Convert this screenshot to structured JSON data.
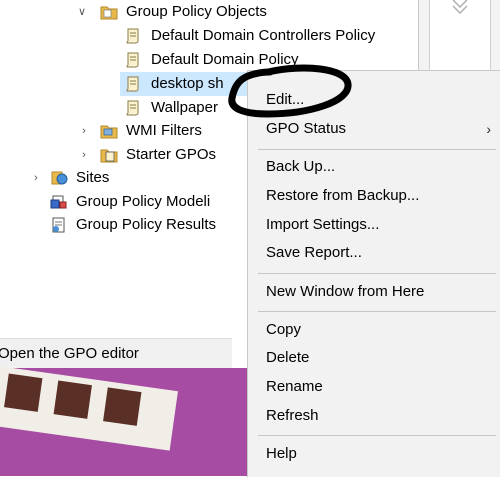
{
  "tree": {
    "items": [
      {
        "label": "Group Policy Objects",
        "icon": "folder-icon",
        "expander": "expanded"
      },
      {
        "label": "Default Domain Controllers Policy",
        "icon": "gpo-scroll-icon"
      },
      {
        "label": "Default Domain Policy",
        "icon": "gpo-scroll-icon"
      },
      {
        "label": "desktop sh",
        "icon": "gpo-scroll-icon"
      },
      {
        "label": "Wallpaper",
        "icon": "gpo-scroll-icon"
      },
      {
        "label": "WMI Filters",
        "icon": "folder-icon",
        "expander": "collapsed"
      },
      {
        "label": "Starter GPOs",
        "icon": "folder-icon",
        "expander": "collapsed"
      },
      {
        "label": "Sites",
        "icon": "sites-icon",
        "expander": "collapsed"
      },
      {
        "label": "Group Policy Modeli",
        "icon": "modeling-icon"
      },
      {
        "label": "Group Policy Results",
        "icon": "results-icon"
      }
    ]
  },
  "status_bar": {
    "text": "Open the GPO editor"
  },
  "context_menu": {
    "items": {
      "edit": "Edit...",
      "gpo_status": "GPO Status",
      "back_up": "Back Up...",
      "restore": "Restore from Backup...",
      "import": "Import Settings...",
      "save_report": "Save Report...",
      "new_window": "New Window from Here",
      "copy": "Copy",
      "delete": "Delete",
      "rename": "Rename",
      "refresh": "Refresh",
      "help": "Help"
    }
  },
  "colors": {
    "selection": "#cce8ff",
    "desktop": "#a64ca3",
    "menu_bg": "#f2f2f2",
    "folder": "#e8b94a"
  }
}
